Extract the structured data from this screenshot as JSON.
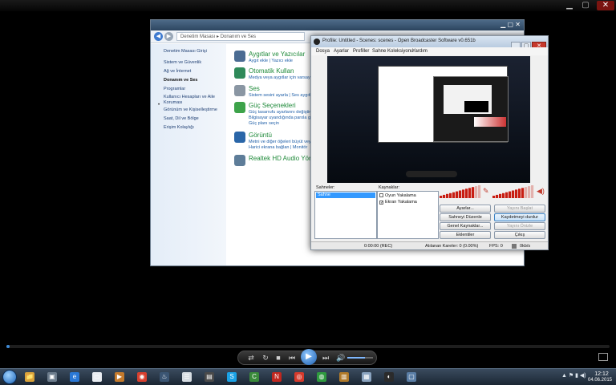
{
  "player": {
    "controls": {
      "shuffle": "⇄",
      "repeat": "↻",
      "stop": "■",
      "prev": "⏮",
      "play": "▶",
      "next": "⏭",
      "volume": "🔊"
    },
    "volume_level": 0.7,
    "seek_progress": 0.005
  },
  "taskbar": {
    "clock_time": "12:12",
    "clock_date": "04.06.2015",
    "apps": [
      {
        "name": "explorer-icon",
        "glyph": "📁",
        "color": "#d9a23a"
      },
      {
        "name": "media-center-icon",
        "glyph": "▣",
        "color": "#6c7c8c"
      },
      {
        "name": "internet-explorer-icon",
        "glyph": "e",
        "color": "#2a78d6"
      },
      {
        "name": "document-icon",
        "glyph": "▭",
        "color": "#e9edf2"
      },
      {
        "name": "video-player-icon",
        "glyph": "▶",
        "color": "#c47a2c"
      },
      {
        "name": "chrome-icon",
        "glyph": "◉",
        "color": "#d8402f"
      },
      {
        "name": "steam-icon",
        "glyph": "♨",
        "color": "#3b5573"
      },
      {
        "name": "text-editor-icon",
        "glyph": "☰",
        "color": "#d7dde3"
      },
      {
        "name": "film-icon",
        "glyph": "▤",
        "color": "#4a4a4a"
      },
      {
        "name": "skype-icon",
        "glyph": "S",
        "color": "#1aa2e6"
      },
      {
        "name": "camtasia-icon",
        "glyph": "C",
        "color": "#3a8a3a"
      },
      {
        "name": "nero-icon",
        "glyph": "N",
        "color": "#c1271f"
      },
      {
        "name": "record-icon",
        "glyph": "◎",
        "color": "#d63a2c"
      },
      {
        "name": "xbox-icon",
        "glyph": "◍",
        "color": "#2f9a3f"
      },
      {
        "name": "equalizer-icon",
        "glyph": "▥",
        "color": "#b07a2a"
      },
      {
        "name": "window-icon",
        "glyph": "▦",
        "color": "#8aa3bf"
      },
      {
        "name": "obs-icon",
        "glyph": "◐",
        "color": "#2b2b2b"
      },
      {
        "name": "tv-icon",
        "glyph": "▢",
        "color": "#5a7ea6"
      }
    ]
  },
  "control_panel": {
    "address": "Denetim Masası  ▸  Donanım ve Ses",
    "sidebar": [
      "Denetim Masası Girişi",
      "Sistem ve Güvenlik",
      "Ağ ve İnternet",
      "Donanım ve Ses",
      "Programlar",
      "Kullanıcı Hesapları ve Aile Koruması",
      "Görünüm ve Kişiselleştirme",
      "Saat, Dil ve Bölge",
      "Erişim Kolaylığı"
    ],
    "categories": [
      {
        "title": "Aygıtlar ve Yazıcılar",
        "links": "Aygıt ekle | Yazıcı ekle",
        "color": "#4b6c93"
      },
      {
        "title": "Otomatik Kullan",
        "links": "Medya veya aygıtlar için varsayılanı",
        "color": "#2f8a5a"
      },
      {
        "title": "Ses",
        "links": "Sistem sesini ayarla | Ses aygıtlarını",
        "color": "#8a96a3"
      },
      {
        "title": "Güç Seçenekleri",
        "links": "Güç tasarrufu ayarlarını değiştir | Güç\nBilgisayar uyandığında parola gereksin\nGüç planı seçin",
        "color": "#3da34a"
      },
      {
        "title": "Görüntü",
        "links": "Metni ve diğer öğeleri büyüt veya küçült\nHarici ekrana bağlan | Monitör",
        "color": "#2a66a8"
      },
      {
        "title": "Realtek HD Audio Yönetici",
        "links": "",
        "color": "#5e7d99"
      }
    ]
  },
  "obs": {
    "title": "Profile: Untitled - Scenes: scenes - Open Broadcaster Software v0.651b",
    "menu": [
      "Dosya",
      "Ayarlar",
      "Profiller",
      "Sahne Koleksiyonu",
      "Yardım"
    ],
    "scenes_label": "Sahneler:",
    "scenes": [
      "Sahne"
    ],
    "sources_label": "Kaynaklar:",
    "sources": [
      {
        "label": "Oyun Yakalama",
        "checked": false
      },
      {
        "label": "Ekran Yakalama",
        "checked": true
      }
    ],
    "buttons": {
      "settings": "Ayarlar...",
      "start_stream": "Yayını Başlat",
      "scene_buttons": "Sahneyi Düzenle",
      "stop_record": "Kaydetmeyi durdur",
      "global_sources": "Genel Kaynaklar...",
      "preview": "Yayını Önizle",
      "plugins": "Eklentiler",
      "exit": "Çıkış"
    },
    "mic_level": 0.82,
    "desktop_level": 0.75,
    "status": {
      "time": "0:00:00 (REC)",
      "dropped": "Atılanan Kareler: 0 (0.00%)",
      "fps": "FPS: 0",
      "bitrate": "0kb/s"
    }
  }
}
